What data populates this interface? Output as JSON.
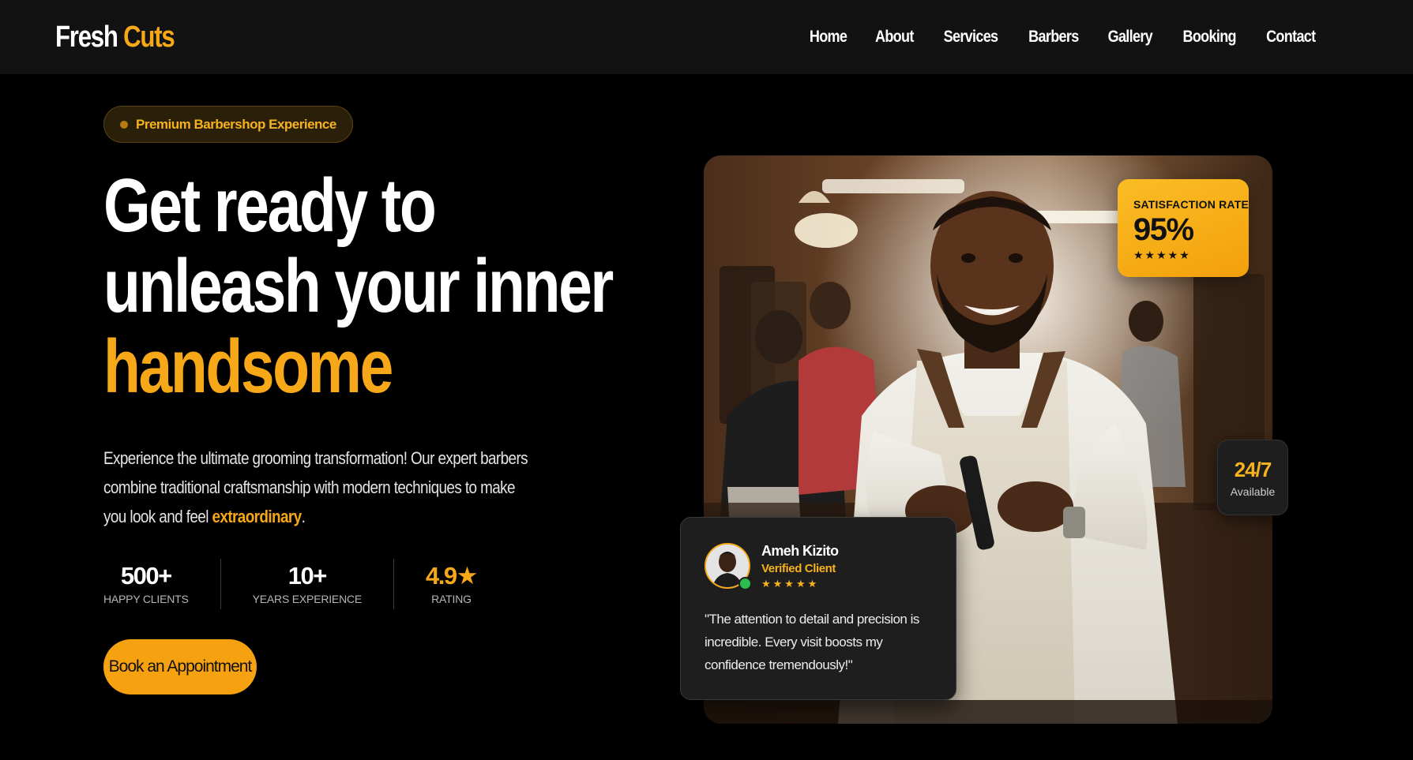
{
  "brand": {
    "name_part_1": "Fresh",
    "name_part_2": "Cuts",
    "accent_color": "#f6a819"
  },
  "nav": {
    "items": [
      {
        "label": "Home"
      },
      {
        "label": "About"
      },
      {
        "label": "Services"
      },
      {
        "label": "Barbers"
      },
      {
        "label": "Gallery"
      },
      {
        "label": "Booking"
      },
      {
        "label": "Contact"
      }
    ]
  },
  "hero": {
    "badge": "Premium Barbershop Experience",
    "headline_line_1": "Get ready to",
    "headline_line_2": "unleash your inner",
    "headline_line_3": "handsome",
    "description_main": "Experience the ultimate grooming transformation! Our expert barbers combine traditional craftsmanship with modern techniques to make you look and feel ",
    "description_highlight": "extraordinary",
    "description_end": ".",
    "cta_label": "Book an Appointment"
  },
  "stats": [
    {
      "value": "500+",
      "label": "Happy Clients"
    },
    {
      "value": "10+",
      "label": "Years Experience"
    },
    {
      "value": "4.9★",
      "label": "Rating"
    }
  ],
  "satisfaction": {
    "label": "SATISFACTION RATE",
    "value": "95%",
    "stars": "★★★★★"
  },
  "availability": {
    "value": "24/7",
    "label": "Available"
  },
  "review": {
    "name": "Ameh Kizito",
    "role": "Verified Client",
    "stars": "★★★★★",
    "text": "\"The attention to detail and precision is incredible. Every visit boosts my confidence tremendously!\""
  }
}
